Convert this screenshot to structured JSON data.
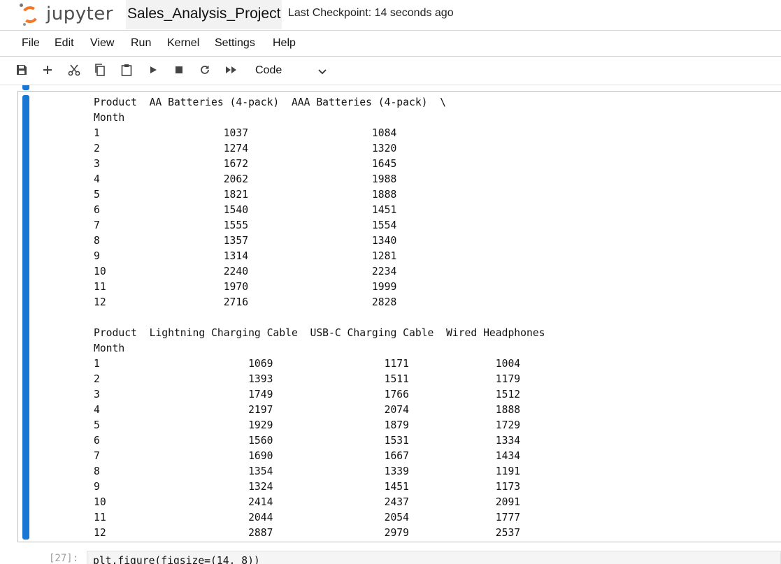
{
  "header": {
    "logo_text": "jupyter",
    "notebook_title": "Sales_Analysis_Project",
    "checkpoint": "Last Checkpoint: 14 seconds ago"
  },
  "menu": [
    "File",
    "Edit",
    "View",
    "Run",
    "Kernel",
    "Settings",
    "Help"
  ],
  "toolbar": {
    "icons": [
      "save-icon",
      "add-icon",
      "cut-icon",
      "copy-icon",
      "paste-icon",
      "run-icon",
      "stop-icon",
      "restart-icon",
      "run-all-icon"
    ],
    "cell_type": "Code"
  },
  "output": {
    "table1": {
      "header": "Product  AA Batteries (4-pack)  AAA Batteries (4-pack)  \\",
      "index_label": "Month",
      "rows": [
        "1                    1037                    1084",
        "2                    1274                    1320",
        "3                    1672                    1645",
        "4                    2062                    1988",
        "5                    1821                    1888",
        "6                    1540                    1451",
        "7                    1555                    1554",
        "8                    1357                    1340",
        "9                    1314                    1281",
        "10                   2240                    2234",
        "11                   1970                    1999",
        "12                   2716                    2828"
      ]
    },
    "table2": {
      "header": "Product  Lightning Charging Cable  USB-C Charging Cable  Wired Headphones",
      "index_label": "Month",
      "rows": [
        "1                        1069                  1171              1004",
        "2                        1393                  1511              1179",
        "3                        1749                  1766              1512",
        "4                        2197                  2074              1888",
        "5                        1929                  1879              1729",
        "6                        1560                  1531              1334",
        "7                        1690                  1667              1434",
        "8                        1354                  1339              1191",
        "9                        1324                  1451              1173",
        "10                       2414                  2437              2091",
        "11                       2044                  2054              1777",
        "12                       2887                  2979              2537"
      ]
    }
  },
  "next_cell": {
    "prompt": "[27]:",
    "code": "plt.figure(figsize=(14, 8))"
  },
  "colors": {
    "accent": "#1976d2",
    "logo_orange": "#f37726"
  }
}
